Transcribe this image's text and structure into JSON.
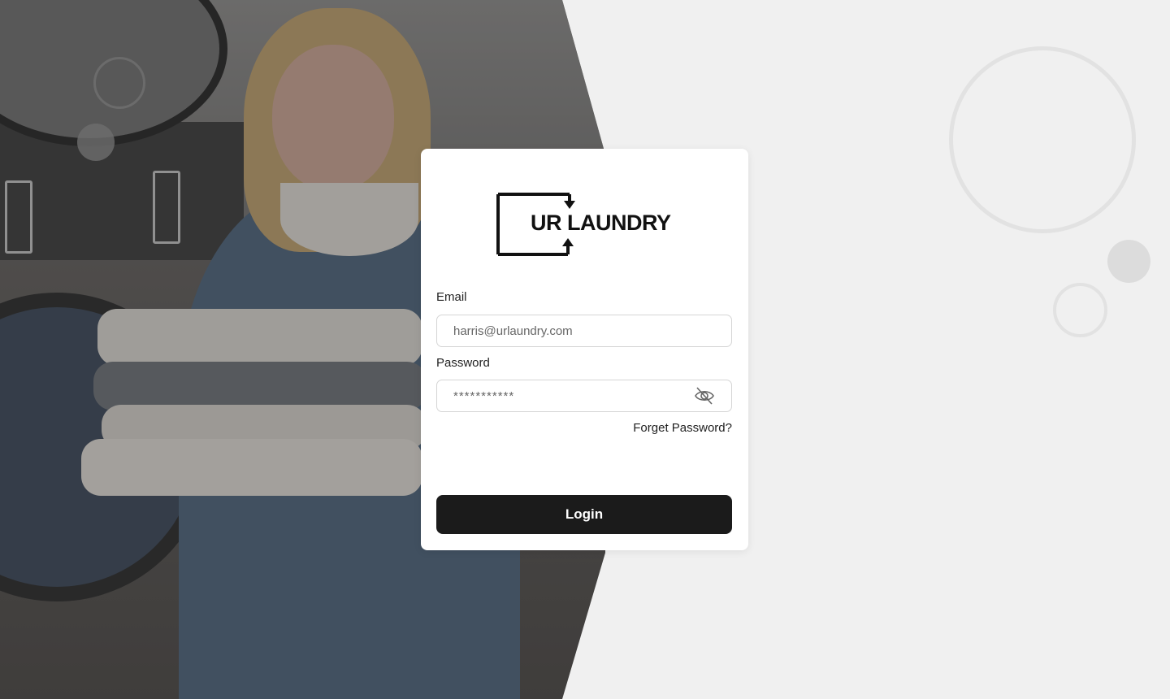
{
  "brand": {
    "logo_text": "UR LAUNDRY",
    "logo_icon": "laundry-arrows-frame-icon"
  },
  "form": {
    "email_label": "Email",
    "email_value": "harris@urlaundry.com",
    "password_label": "Password",
    "password_value": "***********",
    "password_toggle_icon": "eye-off-icon",
    "forgot_password": "Forget Password?",
    "login_button": "Login"
  },
  "colors": {
    "background": "#f0f0f0",
    "card": "#ffffff",
    "button": "#1b1b1b",
    "button_text": "#ffffff",
    "decor_circle": "#e2e2e2"
  }
}
